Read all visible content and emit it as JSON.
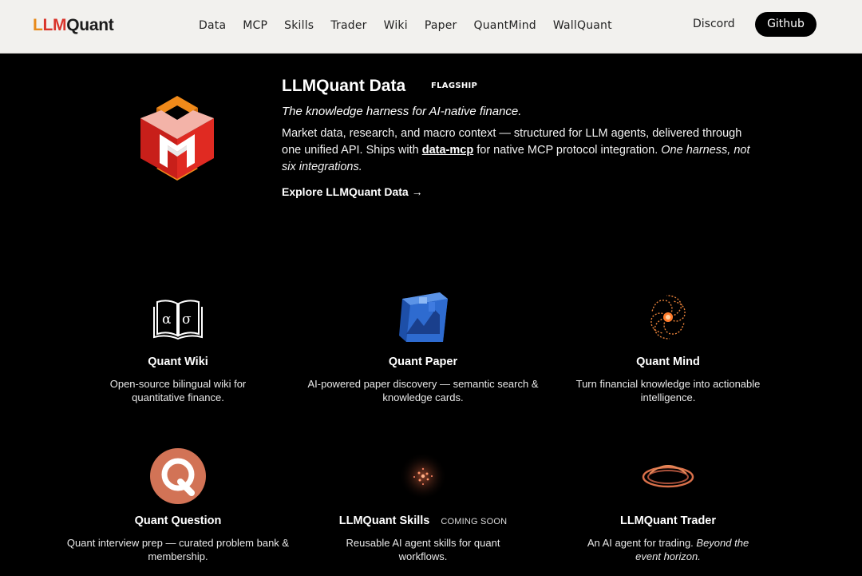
{
  "header": {
    "logo_parts": [
      "L",
      "LM",
      "Quant"
    ],
    "nav": [
      "Data",
      "MCP",
      "Skills",
      "Trader",
      "Wiki",
      "Paper",
      "QuantMind",
      "WallQuant"
    ],
    "discord": "Discord",
    "github": "Github"
  },
  "hero": {
    "title": "LLMQuant Data",
    "badge": "FLAGSHIP",
    "tagline": "The knowledge harness for AI-native finance.",
    "desc_before": "Market data, research, and macro context — structured for LLM agents, delivered through one unified API. Ships with ",
    "desc_link": "data-mcp",
    "desc_after": " for native MCP protocol integration. ",
    "desc_italic": "One harness, not six integrations.",
    "explore": "Explore LLMQuant Data →"
  },
  "cards": [
    {
      "title": "Quant Wiki",
      "text": "Open-source bilingual wiki for quantitative finance.",
      "icon": "open-book-icon"
    },
    {
      "title": "Quant Paper",
      "text": "AI-powered paper discovery — semantic search & knowledge cards.",
      "icon": "paper-cube-icon"
    },
    {
      "title": "Quant Mind",
      "text": "Turn financial knowledge into actionable intelligence.",
      "icon": "spiral-galaxy-icon"
    },
    {
      "title": "Quant Question",
      "text": "Quant interview prep — curated problem bank & membership.",
      "icon": "q-circle-icon"
    },
    {
      "title": "LLMQuant Skills",
      "badge": "COMING SOON",
      "text": "Reusable AI agent skills for quant workflows.",
      "icon": "glow-particles-icon"
    },
    {
      "title": "LLMQuant Trader",
      "text_plain": "An AI agent for trading. ",
      "text_italic": "Beyond the event horizon.",
      "icon": "black-hole-icon"
    }
  ],
  "colors": {
    "accent_orange": "#e88a1a",
    "accent_red": "#d9342b",
    "header_bg": "#f2f1ee",
    "page_bg": "#000000"
  }
}
